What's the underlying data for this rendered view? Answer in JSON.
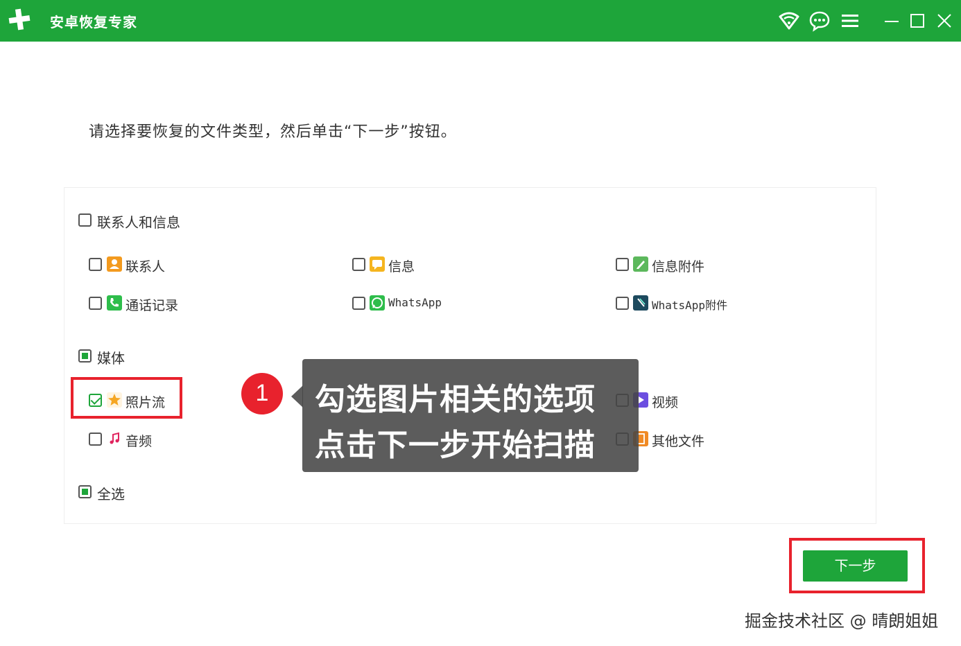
{
  "titlebar": {
    "title": "安卓恢复专家",
    "icons": [
      "wifi-icon",
      "chat-icon",
      "menu-icon",
      "minimize-icon",
      "maximize-icon",
      "close-icon"
    ],
    "bg_color": "#1ea53a"
  },
  "instruction": "请选择要恢复的文件类型，然后单击“下一步”按钮。",
  "groups": {
    "contacts_messages": {
      "label": "联系人和信息",
      "items": {
        "contacts": "联系人",
        "messages": "信息",
        "message_attachments": "信息附件",
        "call_logs": "通话记录",
        "whatsapp": "WhatsApp",
        "whatsapp_attachments": "WhatsApp附件"
      }
    },
    "media": {
      "label": "媒体",
      "items": {
        "photos": "照片流",
        "video": "视频",
        "audio": "音频",
        "other_files": "其他文件"
      }
    },
    "select_all": "全选"
  },
  "states": {
    "contacts_messages": "unchecked",
    "media": "partial",
    "photos": "checked",
    "select_all": "partial"
  },
  "callout": {
    "step_number": "1",
    "line1": "勾选图片相关的选项",
    "line2": "点击下一步开始扫描"
  },
  "next_button": "下一步",
  "watermark": "掘金技术社区 @ 晴朗姐姐",
  "colors": {
    "accent": "#1ea53a",
    "highlight": "#e8222d"
  }
}
